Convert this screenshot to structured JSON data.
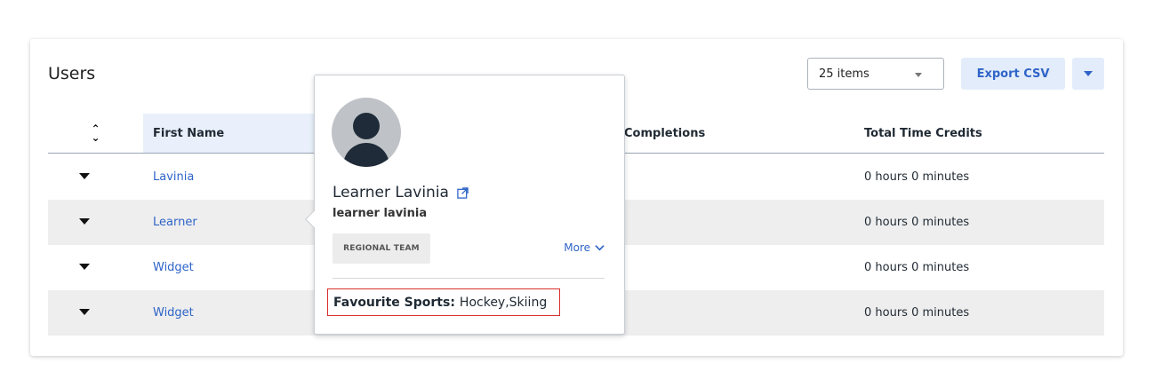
{
  "card": {
    "title": "Users",
    "items_select": {
      "value": "25 items"
    },
    "export_label": "Export CSV"
  },
  "table": {
    "columns": {
      "first_name": "First Name",
      "completions": "Completions",
      "total_time_credits": "Total Time Credits"
    },
    "sort_direction": "ascending",
    "rows": [
      {
        "first_name": "Lavinia",
        "total_time_credits": "0 hours 0 minutes"
      },
      {
        "first_name": "Learner",
        "total_time_credits": "0 hours 0 minutes"
      },
      {
        "first_name": "Widget",
        "total_time_credits": "0 hours 0 minutes"
      },
      {
        "first_name": "Widget",
        "total_time_credits": "0 hours 0 minutes"
      }
    ]
  },
  "popover": {
    "name": "Learner Lavinia",
    "username": "learner lavinia",
    "team_badge": "REGIONAL TEAM",
    "more_label": "More",
    "favourite_label": "Favourite Sports:",
    "favourite_value": "Hockey,Skiing"
  },
  "colors": {
    "accent": "#2f64c8",
    "button_bg": "#e3ecfa",
    "row_alt": "#eeeeee",
    "highlight_border": "#d9302c"
  }
}
